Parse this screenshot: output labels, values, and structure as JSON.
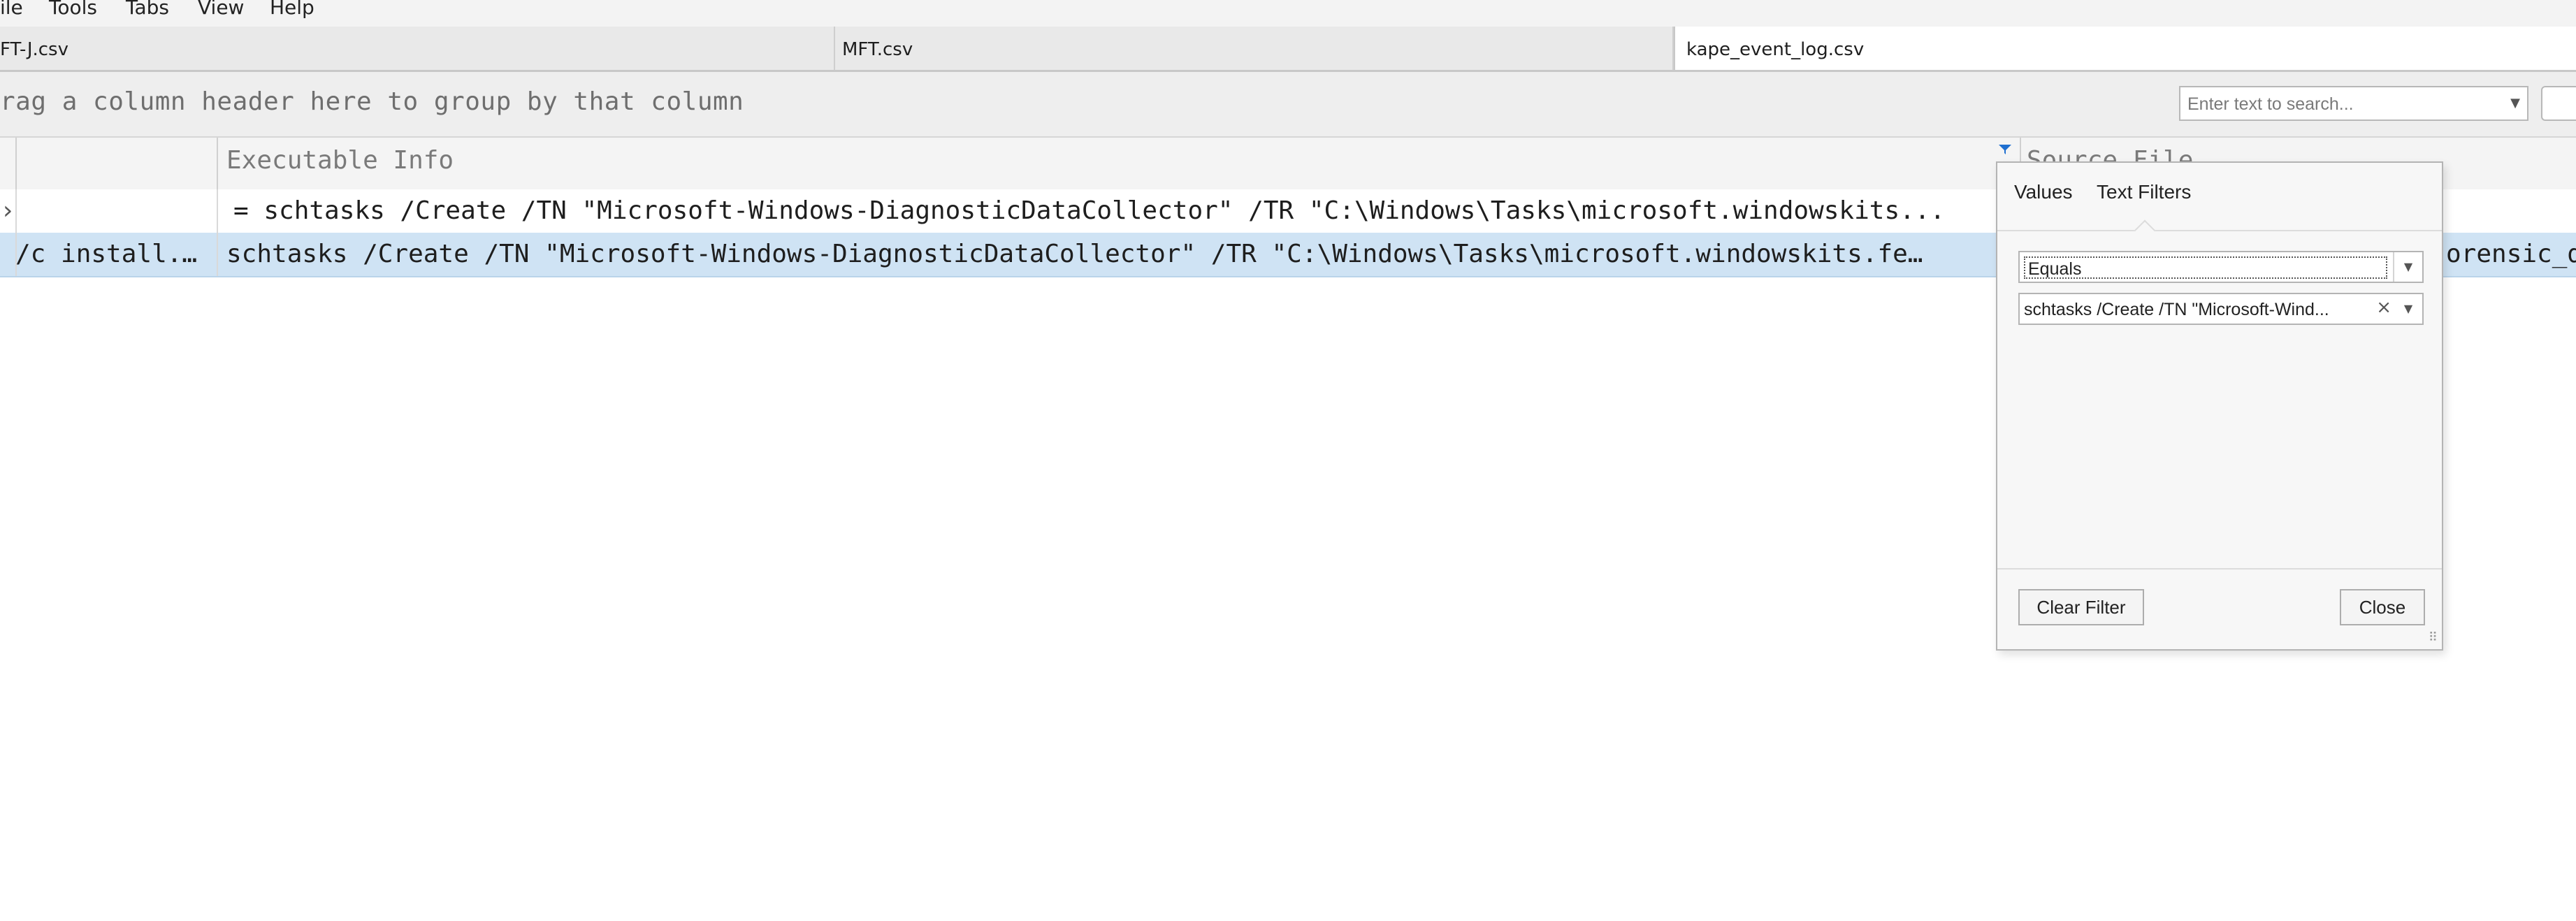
{
  "menu": {
    "items": [
      "ile",
      "Tools",
      "Tabs",
      "View",
      "Help"
    ]
  },
  "tabs": [
    {
      "label": "FT-J.csv",
      "active": false
    },
    {
      "label": "MFT.csv",
      "active": false
    },
    {
      "label": "kape_event_log.csv",
      "active": true
    }
  ],
  "group_panel": {
    "hint": "rag a column header here to group by that column",
    "search_placeholder": "Enter text to search..."
  },
  "grid": {
    "columns": [
      "Executable Info",
      "Source File"
    ],
    "filter_row": {
      "col2": "= schtasks  /Create /TN \"Microsoft-Windows-DiagnosticDataCollector\" /TR \"C:\\Windows\\Tasks\\microsoft.windowskits..."
    },
    "rows": [
      {
        "col1": "/c install.…",
        "col2": "schtasks  /Create /TN \"Microsoft-Windows-DiagnosticDataCollector\" /TR \"C:\\Windows\\Tasks\\microsoft.windowskits.fe…",
        "col3": "orensic_d"
      }
    ]
  },
  "filter_popup": {
    "tab_values": "Values",
    "tab_text_filters": "Text Filters",
    "operator": "Equals",
    "value": "schtasks  /Create /TN \"Microsoft-Wind...",
    "clear_button": "Clear Filter",
    "close_button": "Close"
  },
  "colors": {
    "selected_row": "#cfe3f4",
    "filter_icon": "#1f6fd0"
  }
}
